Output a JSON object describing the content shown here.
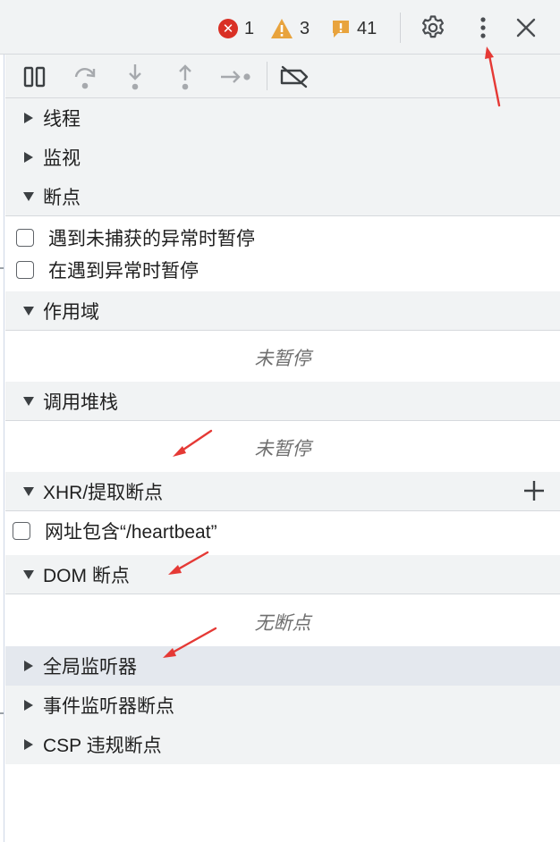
{
  "status": {
    "errors": "1",
    "warnings": "3",
    "issues": "41"
  },
  "status_colors": {
    "error": "#d93025",
    "warning": "#e8a33d",
    "issue": "#e8a33d"
  },
  "top_icons": [
    "error-icon",
    "warning-icon",
    "issue-icon",
    "gear-icon",
    "more-vertical-icon",
    "close-icon"
  ],
  "toolbar_icons": [
    "pause-icon",
    "step-over-icon",
    "step-into-icon",
    "step-out-icon",
    "step-icon",
    "deactivate-breakpoints-icon"
  ],
  "sections": {
    "threads": "线程",
    "watch": "监视",
    "breakpoints": "断点",
    "scope": "作用域",
    "call_stack": "调用堆栈",
    "xhr_breakpoints": "XHR/提取断点",
    "dom_breakpoints": "DOM 断点",
    "global_listeners": "全局监听器",
    "event_listener_breakpoints": "事件监听器断点",
    "csp_breakpoints": "CSP 违规断点"
  },
  "breakpoints": {
    "pause_uncaught": "遇到未捕获的异常时暂停",
    "pause_caught": "在遇到异常时暂停"
  },
  "scope_placeholder": "未暂停",
  "callstack_placeholder": "未暂停",
  "xhr_item": "网址包含“/heartbeat”",
  "dom_placeholder": "无断点",
  "annotation_color": "#e53935"
}
